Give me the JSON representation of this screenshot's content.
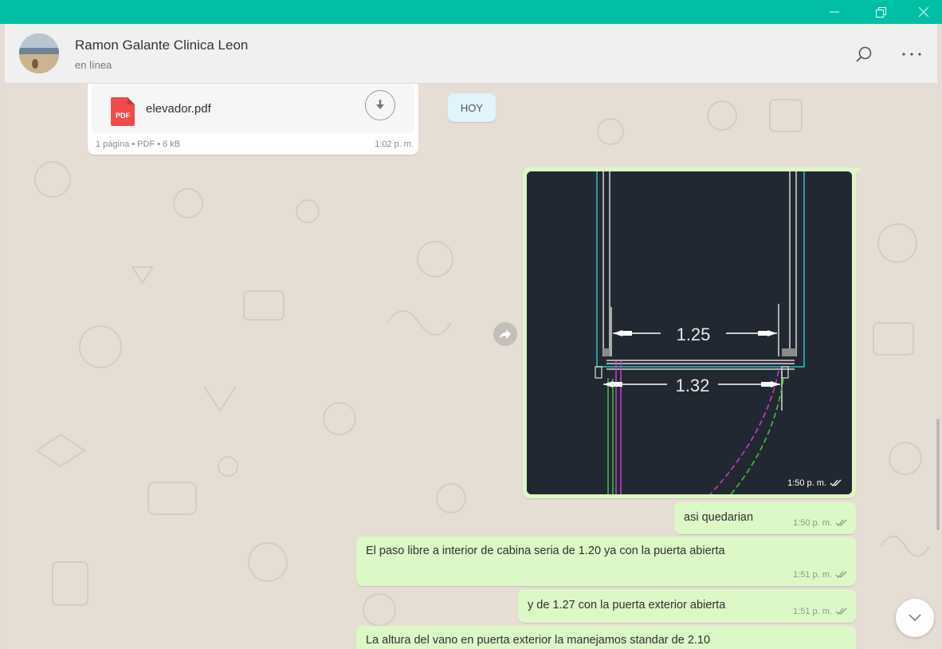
{
  "header": {
    "contact_name": "Ramon Galante Clinica Leon",
    "contact_status": "en línea"
  },
  "theme": {
    "accent": "#00bfa5",
    "outgoing_bubble": "#dcf8c6",
    "incoming_bubble": "#ffffff",
    "chat_background": "#e5ddd5"
  },
  "icons": {
    "search": "search-icon",
    "menu": "more-options-icon",
    "pdf": "pdf-icon",
    "download": "download-icon",
    "forward": "forward-icon",
    "read_receipt": "double-check-icon",
    "scroll_down": "chevron-down-icon"
  },
  "document_message": {
    "icon_label": "PDF",
    "file_name": "elevador.pdf",
    "meta": "1 página • PDF • 6 kB",
    "time": "1:02 p. m."
  },
  "day_divider": "HOY",
  "image_message": {
    "time": "1:50 p. m.",
    "dimension_inner": "1.25",
    "dimension_outer": "1.32"
  },
  "messages": [
    {
      "text": "asi quedarian",
      "time": "1:50 p. m."
    },
    {
      "text": "El paso libre a interior de cabina seria de 1.20 ya con la puerta abierta",
      "time": "1:51 p. m."
    },
    {
      "text": "y de 1.27 con la puerta exterior abierta",
      "time": "1:51 p. m."
    },
    {
      "text": "La altura del vano en puerta exterior la manejamos standar de 2.10",
      "time": ""
    }
  ]
}
